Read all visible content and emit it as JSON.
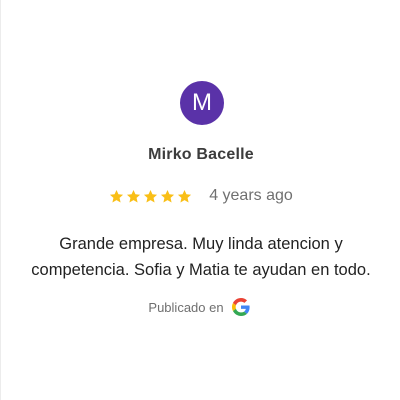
{
  "reviewer": {
    "initial": "M",
    "name": "Mirko Bacelle",
    "avatar_color": "#5a32a8"
  },
  "rating": {
    "stars": 5,
    "max_stars": 5,
    "star_color": "#f9bf17",
    "icon": "star-icon"
  },
  "time_ago": "4 years ago",
  "review_text": "Grande empresa. Muy linda atencion y competencia. Sofia y Matia te ayudan en todo.",
  "source": {
    "label": "Publicado en",
    "icon": "google-logo-icon"
  }
}
